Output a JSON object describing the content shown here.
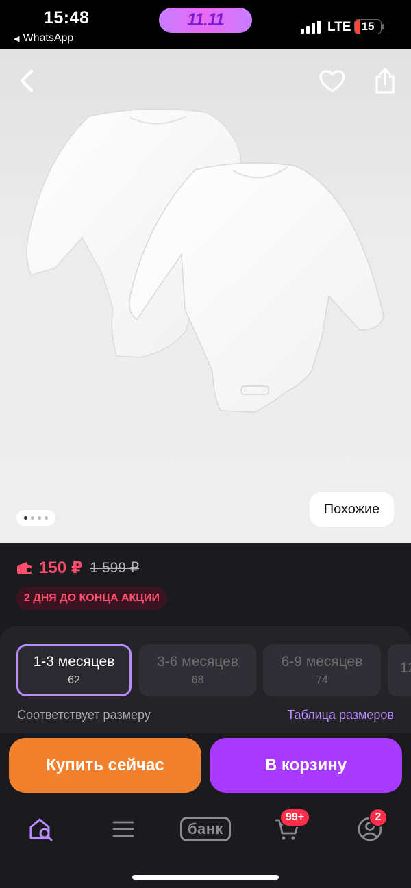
{
  "status_bar": {
    "time": "15:48",
    "back_app": "WhatsApp",
    "promo_label": "11.11",
    "network": "LTE",
    "battery": "15"
  },
  "hero": {
    "similar_label": "Похожие",
    "carousel": {
      "total": 4,
      "active": 1
    }
  },
  "price": {
    "current": "150 ₽",
    "old": "1 599 ₽",
    "promo_badge": "2 ДНЯ ДО КОНЦА АКЦИИ",
    "accent_color": "#ff4d6d"
  },
  "sizes": {
    "options": [
      {
        "label": "1-3 месяцев",
        "sub": "62",
        "selected": true
      },
      {
        "label": "3-6 месяцев",
        "sub": "68",
        "selected": false
      },
      {
        "label": "6-9 месяцев",
        "sub": "74",
        "selected": false
      },
      {
        "label": "12",
        "sub": "",
        "selected": false
      }
    ],
    "fit_hint": "Соответствует размеру",
    "size_table_link": "Таблица размеров"
  },
  "actions": {
    "buy_now": "Купить сейчас",
    "add_to_cart": "В корзину",
    "buy_color": "#f2812d",
    "cart_color": "#a73afd"
  },
  "bottom_nav": {
    "items": [
      {
        "name": "home-search",
        "icon": "home-search-icon"
      },
      {
        "name": "catalog",
        "icon": "menu-icon"
      },
      {
        "name": "bank",
        "label": "банк"
      },
      {
        "name": "cart",
        "icon": "cart-icon",
        "badge": "99+"
      },
      {
        "name": "profile",
        "icon": "profile-icon",
        "badge": "2"
      }
    ]
  }
}
